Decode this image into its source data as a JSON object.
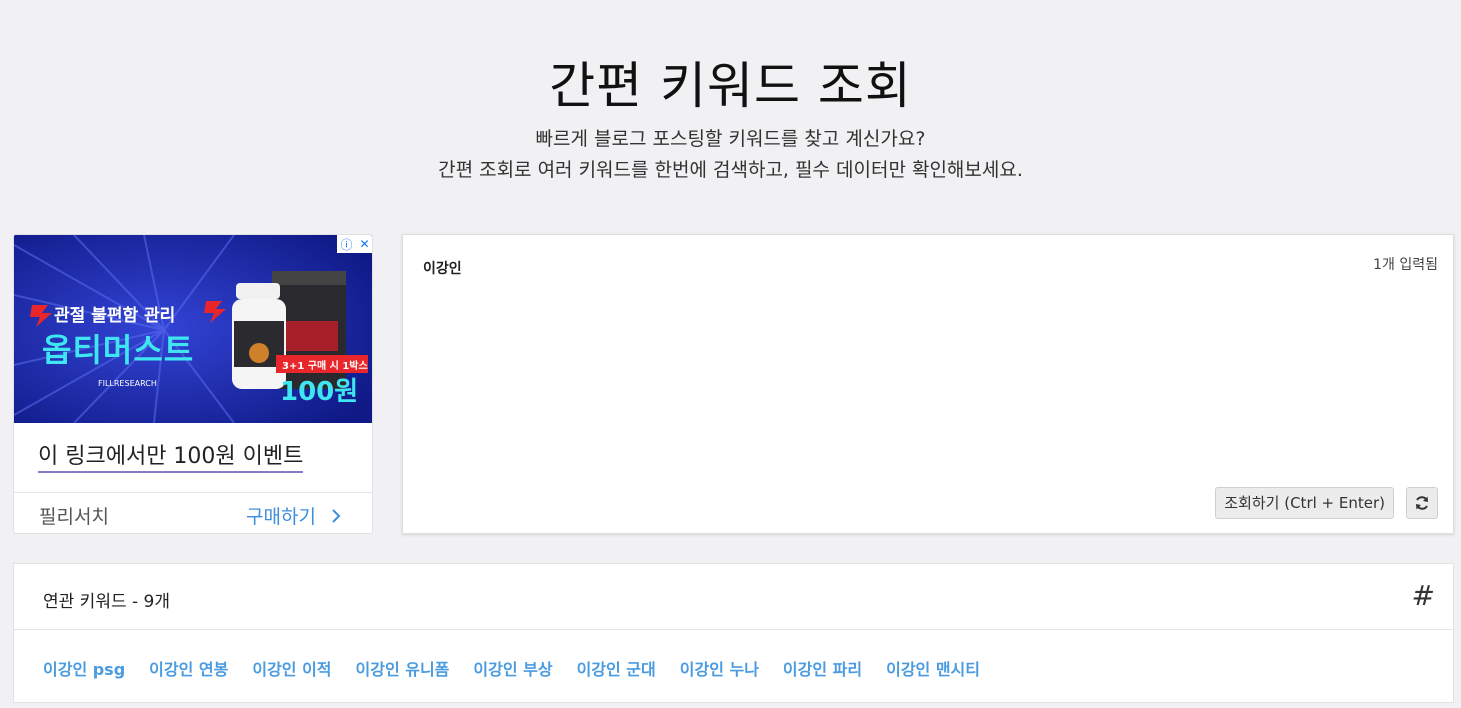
{
  "header": {
    "title": "간편 키워드 조회",
    "subtitle_line1": "빠르게 블로그 포스팅할 키워드를 찾고 계신가요?",
    "subtitle_line2": "간편 조회로 여러 키워드를 한번에 검색하고, 필수 데이터만 확인해보세요."
  },
  "ad": {
    "image_headline_top": "관절 불편함 관리",
    "image_headline_main": "옵티머스트",
    "image_brand": "FILLRESEARCH",
    "image_offer": "3+1 구매 시 1박스",
    "image_price": "100원",
    "link_text": "이 링크에서만 100원 이벤트",
    "advertiser": "필리서치",
    "cta": "구매하기",
    "badge_info": "ⓘ",
    "badge_close": "✕"
  },
  "input": {
    "keyword_text": "이강인",
    "count_label": "1개 입력됨",
    "query_button": "조회하기 (Ctrl + Enter)"
  },
  "related": {
    "title": "연관 키워드 - 9개",
    "hash": "#",
    "keywords": [
      "이강인 psg",
      "이강인 연봉",
      "이강인 이적",
      "이강인 유니폼",
      "이강인 부상",
      "이강인 군대",
      "이강인 누나",
      "이강인 파리",
      "이강인 맨시티"
    ]
  },
  "colors": {
    "background": "#f1f1f3",
    "keyword_link": "#4a9be0",
    "cta": "#3d8fdb",
    "ad_bg": "#1a2aa8"
  }
}
